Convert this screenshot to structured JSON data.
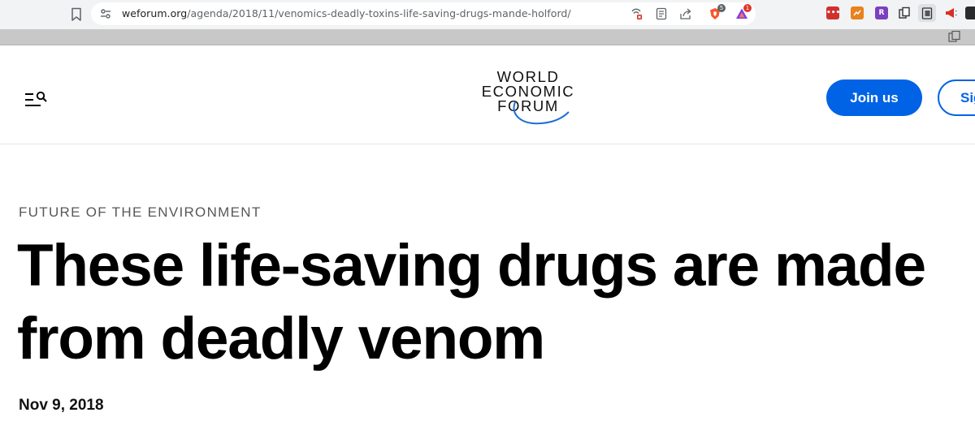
{
  "browser": {
    "url_domain": "weforum.org",
    "url_path": "/agenda/2018/11/venomics-deadly-toxins-life-saving-drugs-mande-holford/",
    "omnibox_icons": [
      "cast-blocked-icon",
      "reader-mode-icon",
      "share-icon"
    ],
    "extensions": [
      {
        "name": "brave-shield-icon",
        "badge": "5"
      },
      {
        "name": "brave-rewards-icon",
        "badge": "1"
      },
      {
        "name": "red-extension-icon",
        "label": "•••"
      },
      {
        "name": "orange-extension-icon",
        "label": ""
      },
      {
        "name": "purple-extension-icon",
        "label": "R"
      },
      {
        "name": "copy-extension-icon",
        "label": ""
      },
      {
        "name": "clipboard-extension-icon",
        "label": ""
      },
      {
        "name": "megaphone-extension-icon",
        "label": ""
      }
    ]
  },
  "header": {
    "logo": {
      "line1": "WORLD",
      "line2": "ECONOMIC",
      "line3": "FORUM"
    },
    "join_label": "Join us",
    "signin_label": "Sign in",
    "accent_color": "#0063e6"
  },
  "article": {
    "topic": "FUTURE OF THE ENVIRONMENT",
    "headline_line1": "These life-saving drugs are made",
    "headline_line2": "from deadly venom",
    "date": "Nov 9, 2018"
  }
}
